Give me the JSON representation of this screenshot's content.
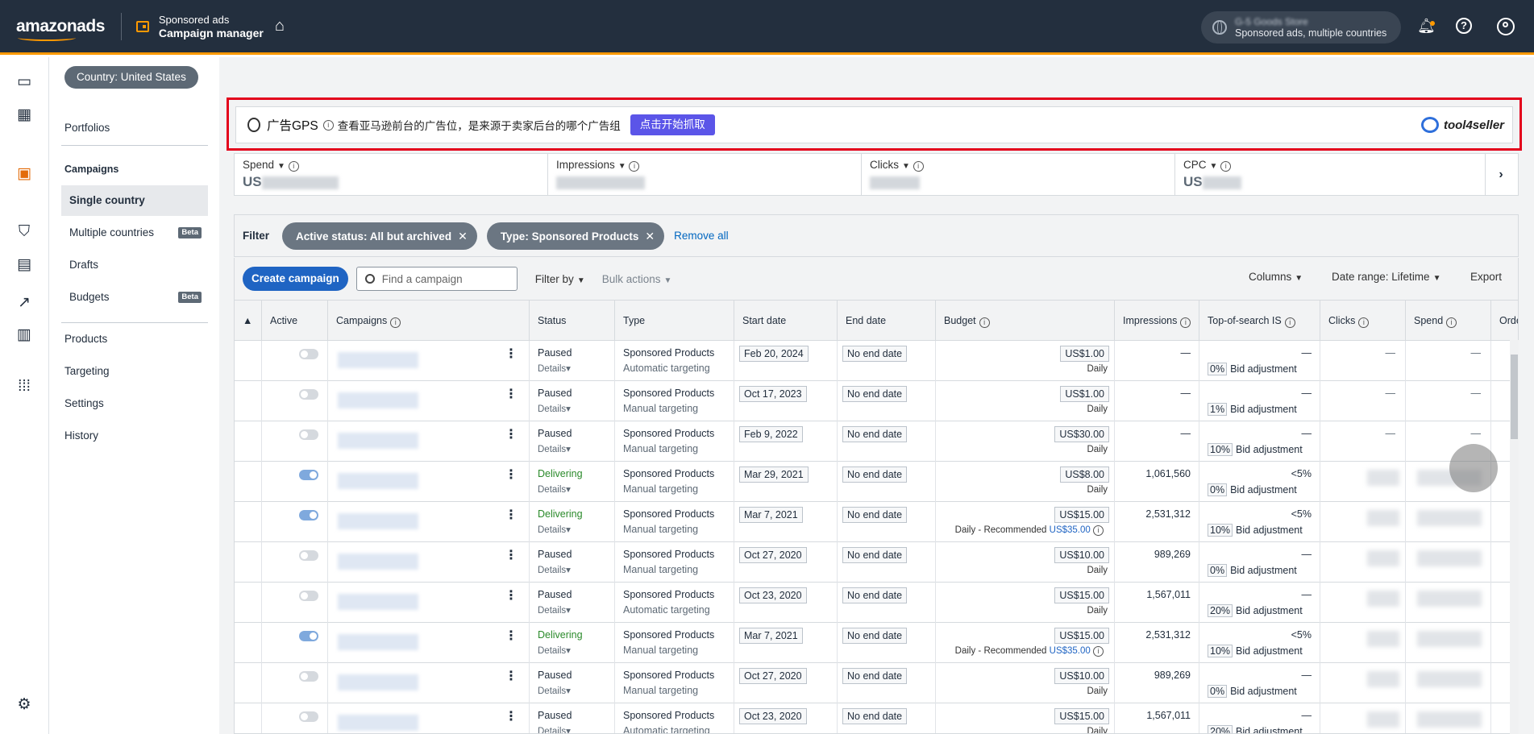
{
  "header": {
    "logo": "amazonads",
    "app_line1": "Sponsored ads",
    "app_line2": "Campaign manager",
    "account_name": "G-5 Goods Store",
    "account_sub": "Sponsored ads, multiple countries"
  },
  "nav": {
    "country": "Country: United States",
    "portfolios": "Portfolios",
    "campaigns_header": "Campaigns",
    "single_country": "Single country",
    "multiple_countries": "Multiple countries",
    "drafts": "Drafts",
    "budgets": "Budgets",
    "beta": "Beta",
    "products": "Products",
    "targeting": "Targeting",
    "settings": "Settings",
    "history": "History"
  },
  "gps": {
    "title": "广告GPS",
    "desc": "查看亚马逊前台的广告位，是来源于卖家后台的哪个广告组",
    "button": "点击开始抓取",
    "brand": "tool4seller"
  },
  "metrics": [
    {
      "label": "Spend",
      "prefix": "US"
    },
    {
      "label": "Impressions",
      "prefix": ""
    },
    {
      "label": "Clicks",
      "prefix": ""
    },
    {
      "label": "CPC",
      "prefix": "US"
    }
  ],
  "filter": {
    "label": "Filter",
    "chip1": "Active status: All but archived",
    "chip2": "Type: Sponsored Products",
    "remove_all": "Remove all"
  },
  "toolbar": {
    "create": "Create campaign",
    "search_placeholder": "Find a campaign",
    "filter_by": "Filter by",
    "bulk": "Bulk actions",
    "columns": "Columns",
    "date_range": "Date range: Lifetime",
    "export": "Export"
  },
  "columns": {
    "active": "Active",
    "campaigns": "Campaigns",
    "status": "Status",
    "type": "Type",
    "start": "Start date",
    "end": "End date",
    "budget": "Budget",
    "impressions": "Impressions",
    "tos": "Top-of-search IS",
    "clicks": "Clicks",
    "spend": "Spend",
    "orders": "Orde"
  },
  "labels": {
    "details": "Details",
    "bid_adjustment": "Bid adjustment",
    "daily": "Daily",
    "daily_recommended": "Daily - Recommended"
  },
  "rows": [
    {
      "active": false,
      "status": "Paused",
      "type": "Sponsored Products",
      "targeting": "Automatic targeting",
      "start": "Feb 20, 2024",
      "end": "No end date",
      "budget": "US$1.00",
      "rec": "",
      "impressions": "—",
      "tos": "—",
      "bid": "0%",
      "clicks": "—",
      "spend": "—"
    },
    {
      "active": false,
      "status": "Paused",
      "type": "Sponsored Products",
      "targeting": "Manual targeting",
      "start": "Oct 17, 2023",
      "end": "No end date",
      "budget": "US$1.00",
      "rec": "",
      "impressions": "—",
      "tos": "—",
      "bid": "1%",
      "clicks": "—",
      "spend": "—"
    },
    {
      "active": false,
      "status": "Paused",
      "type": "Sponsored Products",
      "targeting": "Manual targeting",
      "start": "Feb 9, 2022",
      "end": "No end date",
      "budget": "US$30.00",
      "rec": "",
      "impressions": "—",
      "tos": "—",
      "bid": "10%",
      "clicks": "—",
      "spend": "—"
    },
    {
      "active": true,
      "status": "Delivering",
      "type": "Sponsored Products",
      "targeting": "Manual targeting",
      "start": "Mar 29, 2021",
      "end": "No end date",
      "budget": "US$8.00",
      "rec": "",
      "impressions": "1,061,560",
      "tos": "<5%",
      "bid": "0%",
      "clicks": "",
      "spend": ""
    },
    {
      "active": true,
      "status": "Delivering",
      "type": "Sponsored Products",
      "targeting": "Manual targeting",
      "start": "Mar 7, 2021",
      "end": "No end date",
      "budget": "US$15.00",
      "rec": "US$35.00",
      "impressions": "2,531,312",
      "tos": "<5%",
      "bid": "10%",
      "clicks": "",
      "spend": ""
    },
    {
      "active": false,
      "status": "Paused",
      "type": "Sponsored Products",
      "targeting": "Manual targeting",
      "start": "Oct 27, 2020",
      "end": "No end date",
      "budget": "US$10.00",
      "rec": "",
      "impressions": "989,269",
      "tos": "—",
      "bid": "0%",
      "clicks": "",
      "spend": ""
    },
    {
      "active": false,
      "status": "Paused",
      "type": "Sponsored Products",
      "targeting": "Automatic targeting",
      "start": "Oct 23, 2020",
      "end": "No end date",
      "budget": "US$15.00",
      "rec": "",
      "impressions": "1,567,011",
      "tos": "—",
      "bid": "20%",
      "clicks": "",
      "spend": ""
    },
    {
      "active": true,
      "status": "Delivering",
      "type": "Sponsored Products",
      "targeting": "Manual targeting",
      "start": "Mar 7, 2021",
      "end": "No end date",
      "budget": "US$15.00",
      "rec": "US$35.00",
      "impressions": "2,531,312",
      "tos": "<5%",
      "bid": "10%",
      "clicks": "",
      "spend": ""
    },
    {
      "active": false,
      "status": "Paused",
      "type": "Sponsored Products",
      "targeting": "Manual targeting",
      "start": "Oct 27, 2020",
      "end": "No end date",
      "budget": "US$10.00",
      "rec": "",
      "impressions": "989,269",
      "tos": "—",
      "bid": "0%",
      "clicks": "",
      "spend": ""
    },
    {
      "active": false,
      "status": "Paused",
      "type": "Sponsored Products",
      "targeting": "Automatic targeting",
      "start": "Oct 23, 2020",
      "end": "No end date",
      "budget": "US$15.00",
      "rec": "",
      "impressions": "1,567,011",
      "tos": "—",
      "bid": "20%",
      "clicks": "",
      "spend": ""
    }
  ]
}
